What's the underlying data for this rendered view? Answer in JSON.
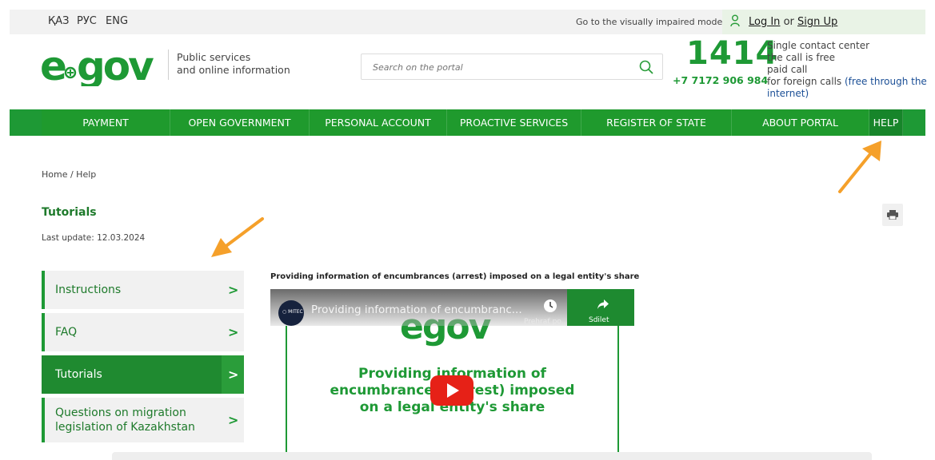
{
  "topbar": {
    "languages": [
      "ҚАЗ",
      "РУС",
      "ENG"
    ],
    "impaired_mode": "Go to the visually impaired mode",
    "login": "Log In",
    "or": " or ",
    "signup": "Sign Up"
  },
  "header": {
    "logo_text": "egov",
    "tagline_line1": "Public services",
    "tagline_line2": "and online information",
    "search_placeholder": "Search on the portal",
    "phone_short": "1414",
    "phone_long": "+7 7172 906 984",
    "contact_line1": "Single contact center",
    "contact_line2": "the call is free",
    "contact_line3": "paid call",
    "contact_line4": "for foreign calls ",
    "contact_free": "(free through the internet)"
  },
  "nav": {
    "items": [
      "PAYMENT",
      "OPEN GOVERNMENT",
      "PERSONAL ACCOUNT",
      "PROACTIVE SERVICES",
      "REGISTER OF STATE SERVICES",
      "ABOUT PORTAL",
      "HELP"
    ]
  },
  "breadcrumb": "Home / Help",
  "page": {
    "title": "Tutorials",
    "last_update": "Last update: 12.03.2024"
  },
  "sidebar": {
    "items": [
      {
        "label": "Instructions"
      },
      {
        "label": "FAQ"
      },
      {
        "label": "Tutorials"
      },
      {
        "label_line1": "Questions on migration",
        "label_line2": "legislation of Kazakhstan"
      }
    ]
  },
  "video": {
    "section_title": "Providing information of encumbrances (arrest) imposed on a legal entity's share",
    "player_title": "Providing information of encumbranc...",
    "watch_later": "Prehrať po...",
    "share": "Sdilet",
    "channel_badge": "○ MITEC",
    "slide_logo": "egov",
    "slide_line1": "Providing information of",
    "slide_line2": "encumbrances (arrest) imposed",
    "slide_line3": "on a legal entity's share"
  },
  "colors": {
    "brand_green": "#1e9935",
    "dark_green": "#1f8a30",
    "arrow_orange": "#f5a02a",
    "youtube_red": "#e62117"
  }
}
